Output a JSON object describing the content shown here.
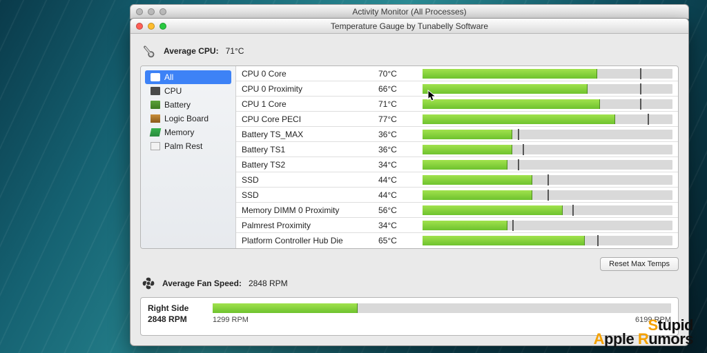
{
  "back_window": {
    "title": "Activity Monitor (All Processes)"
  },
  "window": {
    "title": "Temperature Gauge by Tunabelly Software"
  },
  "header": {
    "avg_cpu_label": "Average CPU:",
    "avg_cpu_value": "71°C"
  },
  "sidebar": {
    "items": [
      {
        "label": "All",
        "icon": "all-icon",
        "selected": true
      },
      {
        "label": "CPU",
        "icon": "cpu-icon",
        "selected": false
      },
      {
        "label": "Battery",
        "icon": "battery-icon",
        "selected": false
      },
      {
        "label": "Logic Board",
        "icon": "logic-board-icon",
        "selected": false
      },
      {
        "label": "Memory",
        "icon": "memory-icon",
        "selected": false
      },
      {
        "label": "Palm Rest",
        "icon": "palmrest-icon",
        "selected": false
      }
    ]
  },
  "sensors": {
    "bar_scale_max_c": 100,
    "rows": [
      {
        "name": "CPU 0 Core",
        "temp_c": 70,
        "temp_label": "70°C",
        "max_pct": 87
      },
      {
        "name": "CPU 0 Proximity",
        "temp_c": 66,
        "temp_label": "66°C",
        "max_pct": 87
      },
      {
        "name": "CPU 1 Core",
        "temp_c": 71,
        "temp_label": "71°C",
        "max_pct": 87
      },
      {
        "name": "CPU Core PECI",
        "temp_c": 77,
        "temp_label": "77°C",
        "max_pct": 90
      },
      {
        "name": "Battery TS_MAX",
        "temp_c": 36,
        "temp_label": "36°C",
        "max_pct": 38
      },
      {
        "name": "Battery TS1",
        "temp_c": 36,
        "temp_label": "36°C",
        "max_pct": 40
      },
      {
        "name": "Battery TS2",
        "temp_c": 34,
        "temp_label": "34°C",
        "max_pct": 38
      },
      {
        "name": "SSD",
        "temp_c": 44,
        "temp_label": "44°C",
        "max_pct": 50
      },
      {
        "name": "SSD",
        "temp_c": 44,
        "temp_label": "44°C",
        "max_pct": 50
      },
      {
        "name": "Memory DIMM 0 Proximity",
        "temp_c": 56,
        "temp_label": "56°C",
        "max_pct": 60
      },
      {
        "name": "Palmrest Proximity",
        "temp_c": 34,
        "temp_label": "34°C",
        "max_pct": 36
      },
      {
        "name": "Platform Controller Hub Die",
        "temp_c": 65,
        "temp_label": "65°C",
        "max_pct": 70
      }
    ]
  },
  "buttons": {
    "reset_max": "Reset Max Temps"
  },
  "fan": {
    "avg_label": "Average Fan Speed:",
    "avg_value": "2848 RPM",
    "name": "Right Side",
    "current_label": "2848 RPM",
    "current_rpm": 2848,
    "min_rpm": 1299,
    "max_rpm": 6199,
    "min_label": "1299 RPM",
    "max_label": "6199 RPM"
  },
  "watermark": {
    "line1_a": "S",
    "line1_b": "tupid",
    "line2_a": "A",
    "line2_b": "pple ",
    "line2_c": "R",
    "line2_d": "umors"
  }
}
